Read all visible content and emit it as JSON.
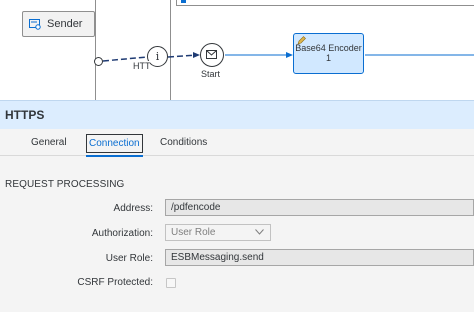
{
  "diagram": {
    "sender_label": "Sender",
    "connection_label": "HTTPS",
    "info_glyph": "i",
    "start_label": "Start",
    "step_label_line1": "Base64 Encoder",
    "step_label_line2": "1"
  },
  "properties": {
    "title": "HTTPS",
    "tabs": [
      {
        "label": "General"
      },
      {
        "label": "Connection",
        "active": true
      },
      {
        "label": "Conditions"
      }
    ],
    "section_title": "REQUEST PROCESSING",
    "address": {
      "label": "Address:",
      "value": "/pdfencode"
    },
    "authorization": {
      "label": "Authorization:",
      "value": "User Role"
    },
    "user_role": {
      "label": "User Role:",
      "value": "ESBMessaging.send"
    },
    "csrf": {
      "label": "CSRF Protected:",
      "checked": false
    }
  },
  "colors": {
    "accent": "#0a6ed1",
    "header_bg": "#dcedfe",
    "step_bg": "#d1e8ff",
    "flow_dashed": "#1f3b73"
  },
  "icons": {
    "sender": "sender-system-icon",
    "info": "info-icon",
    "start": "envelope-icon",
    "step": "pencil-icon",
    "dropdown": "chevron-down-icon"
  }
}
